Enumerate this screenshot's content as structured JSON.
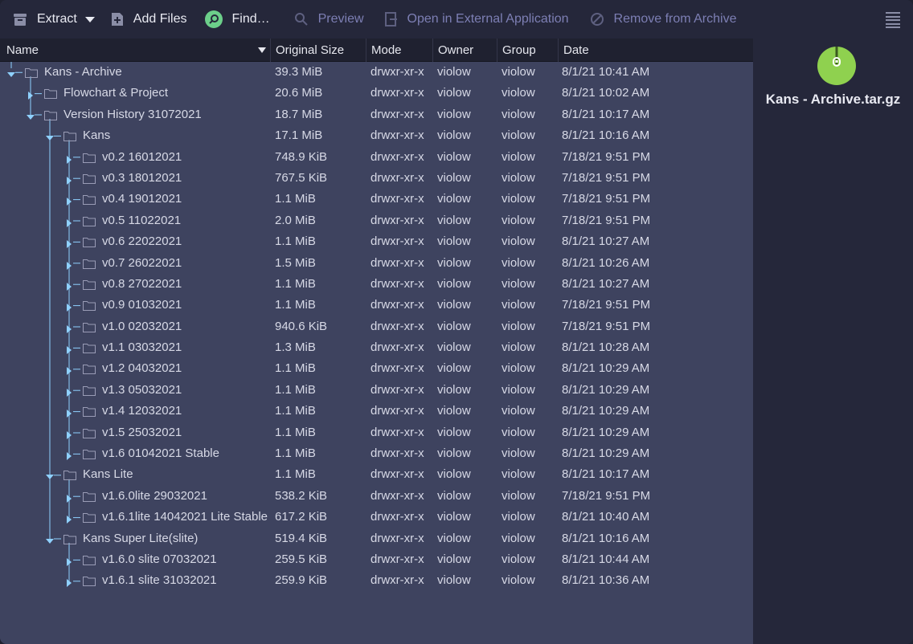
{
  "toolbar": {
    "extract": "Extract",
    "add_files": "Add Files",
    "find": "Find…",
    "preview": "Preview",
    "open_external": "Open in External Application",
    "remove": "Remove from Archive"
  },
  "columns": {
    "name": "Name",
    "size": "Original Size",
    "mode": "Mode",
    "owner": "Owner",
    "group": "Group",
    "date": "Date"
  },
  "rows": [
    {
      "name": "Kans - Archive",
      "size": "39.3 MiB",
      "mode": "drwxr-xr-x",
      "owner": "violow",
      "group": "violow",
      "date": "8/1/21 10:41 AM",
      "level": 0,
      "expanded": true
    },
    {
      "name": "Flowchart & Project",
      "size": "20.6 MiB",
      "mode": "drwxr-xr-x",
      "owner": "violow",
      "group": "violow",
      "date": "8/1/21 10:02 AM",
      "level": 1,
      "expanded": false
    },
    {
      "name": "Version History 31072021",
      "size": "18.7 MiB",
      "mode": "drwxr-xr-x",
      "owner": "violow",
      "group": "violow",
      "date": "8/1/21 10:17 AM",
      "level": 1,
      "expanded": true
    },
    {
      "name": "Kans",
      "size": "17.1 MiB",
      "mode": "drwxr-xr-x",
      "owner": "violow",
      "group": "violow",
      "date": "8/1/21 10:16 AM",
      "level": 2,
      "expanded": true
    },
    {
      "name": "v0.2 16012021",
      "size": "748.9 KiB",
      "mode": "drwxr-xr-x",
      "owner": "violow",
      "group": "violow",
      "date": "7/18/21 9:51 PM",
      "level": 3,
      "expanded": false
    },
    {
      "name": "v0.3 18012021",
      "size": "767.5 KiB",
      "mode": "drwxr-xr-x",
      "owner": "violow",
      "group": "violow",
      "date": "7/18/21 9:51 PM",
      "level": 3,
      "expanded": false
    },
    {
      "name": "v0.4 19012021",
      "size": "1.1 MiB",
      "mode": "drwxr-xr-x",
      "owner": "violow",
      "group": "violow",
      "date": "7/18/21 9:51 PM",
      "level": 3,
      "expanded": false
    },
    {
      "name": "v0.5 11022021",
      "size": "2.0 MiB",
      "mode": "drwxr-xr-x",
      "owner": "violow",
      "group": "violow",
      "date": "7/18/21 9:51 PM",
      "level": 3,
      "expanded": false
    },
    {
      "name": "v0.6 22022021",
      "size": "1.1 MiB",
      "mode": "drwxr-xr-x",
      "owner": "violow",
      "group": "violow",
      "date": "8/1/21 10:27 AM",
      "level": 3,
      "expanded": false
    },
    {
      "name": "v0.7 26022021",
      "size": "1.5 MiB",
      "mode": "drwxr-xr-x",
      "owner": "violow",
      "group": "violow",
      "date": "8/1/21 10:26 AM",
      "level": 3,
      "expanded": false
    },
    {
      "name": "v0.8 27022021",
      "size": "1.1 MiB",
      "mode": "drwxr-xr-x",
      "owner": "violow",
      "group": "violow",
      "date": "8/1/21 10:27 AM",
      "level": 3,
      "expanded": false
    },
    {
      "name": "v0.9 01032021",
      "size": "1.1 MiB",
      "mode": "drwxr-xr-x",
      "owner": "violow",
      "group": "violow",
      "date": "7/18/21 9:51 PM",
      "level": 3,
      "expanded": false
    },
    {
      "name": "v1.0 02032021",
      "size": "940.6 KiB",
      "mode": "drwxr-xr-x",
      "owner": "violow",
      "group": "violow",
      "date": "7/18/21 9:51 PM",
      "level": 3,
      "expanded": false
    },
    {
      "name": "v1.1 03032021",
      "size": "1.3 MiB",
      "mode": "drwxr-xr-x",
      "owner": "violow",
      "group": "violow",
      "date": "8/1/21 10:28 AM",
      "level": 3,
      "expanded": false
    },
    {
      "name": "v1.2 04032021",
      "size": "1.1 MiB",
      "mode": "drwxr-xr-x",
      "owner": "violow",
      "group": "violow",
      "date": "8/1/21 10:29 AM",
      "level": 3,
      "expanded": false
    },
    {
      "name": "v1.3 05032021",
      "size": "1.1 MiB",
      "mode": "drwxr-xr-x",
      "owner": "violow",
      "group": "violow",
      "date": "8/1/21 10:29 AM",
      "level": 3,
      "expanded": false
    },
    {
      "name": "v1.4 12032021",
      "size": "1.1 MiB",
      "mode": "drwxr-xr-x",
      "owner": "violow",
      "group": "violow",
      "date": "8/1/21 10:29 AM",
      "level": 3,
      "expanded": false
    },
    {
      "name": "v1.5 25032021",
      "size": "1.1 MiB",
      "mode": "drwxr-xr-x",
      "owner": "violow",
      "group": "violow",
      "date": "8/1/21 10:29 AM",
      "level": 3,
      "expanded": false
    },
    {
      "name": "v1.6 01042021 Stable",
      "size": "1.1 MiB",
      "mode": "drwxr-xr-x",
      "owner": "violow",
      "group": "violow",
      "date": "8/1/21 10:29 AM",
      "level": 3,
      "expanded": false
    },
    {
      "name": "Kans Lite",
      "size": "1.1 MiB",
      "mode": "drwxr-xr-x",
      "owner": "violow",
      "group": "violow",
      "date": "8/1/21 10:17 AM",
      "level": 2,
      "expanded": true
    },
    {
      "name": "v1.6.0lite 29032021",
      "size": "538.2 KiB",
      "mode": "drwxr-xr-x",
      "owner": "violow",
      "group": "violow",
      "date": "7/18/21 9:51 PM",
      "level": 3,
      "expanded": false
    },
    {
      "name": "v1.6.1lite 14042021 Lite Stable",
      "size": "617.2 KiB",
      "mode": "drwxr-xr-x",
      "owner": "violow",
      "group": "violow",
      "date": "8/1/21 10:40 AM",
      "level": 3,
      "expanded": false
    },
    {
      "name": "Kans Super Lite(slite)",
      "size": "519.4 KiB",
      "mode": "drwxr-xr-x",
      "owner": "violow",
      "group": "violow",
      "date": "8/1/21 10:16 AM",
      "level": 2,
      "expanded": true
    },
    {
      "name": "v1.6.0 slite 07032021",
      "size": "259.5 KiB",
      "mode": "drwxr-xr-x",
      "owner": "violow",
      "group": "violow",
      "date": "8/1/21 10:44 AM",
      "level": 3,
      "expanded": false
    },
    {
      "name": "v1.6.1 slite 31032021",
      "size": "259.9 KiB",
      "mode": "drwxr-xr-x",
      "owner": "violow",
      "group": "violow",
      "date": "8/1/21 10:36 AM",
      "level": 3,
      "expanded": false
    }
  ],
  "side_panel": {
    "filename": "Kans - Archive.tar.gz",
    "icon": "archive-file-icon",
    "icon_color": "#8fd14f"
  },
  "colors": {
    "toolbar_bg": "#25273a",
    "table_bg": "#3e435f",
    "header_bg": "#1f2130",
    "tree_line": "#8fd1ff",
    "disabled_text": "#7d7fb4",
    "find_accent": "#6ccf8a"
  }
}
